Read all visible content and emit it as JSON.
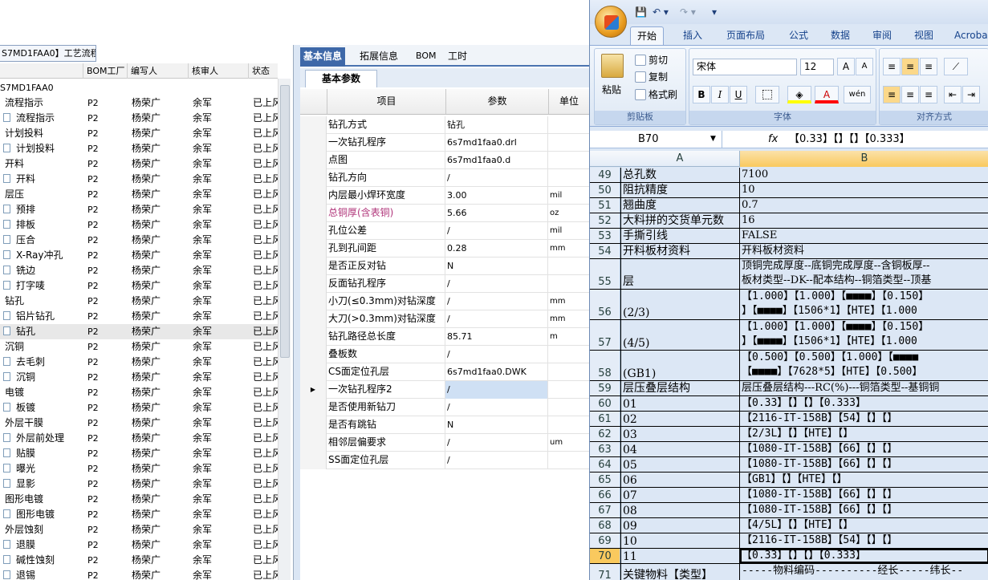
{
  "left_panel": {
    "title": "S7MD1FAA0】工艺流程",
    "headers": [
      "",
      "BOM工厂",
      "编写人",
      "核审人",
      "状态"
    ],
    "root": "S7MD1FAA0",
    "rows": [
      {
        "label": "流程指示",
        "level": 0,
        "factory": "P2",
        "writer": "杨荣广",
        "reviewer": "余军",
        "status": "已上风"
      },
      {
        "label": "流程指示",
        "level": 1,
        "factory": "P2",
        "writer": "杨荣广",
        "reviewer": "余军",
        "status": "已上风"
      },
      {
        "label": "计划投料",
        "level": 0,
        "factory": "P2",
        "writer": "杨荣广",
        "reviewer": "余军",
        "status": "已上风"
      },
      {
        "label": "计划投料",
        "level": 1,
        "factory": "P2",
        "writer": "杨荣广",
        "reviewer": "余军",
        "status": "已上风"
      },
      {
        "label": "开料",
        "level": 0,
        "factory": "P2",
        "writer": "杨荣广",
        "reviewer": "余军",
        "status": "已上风"
      },
      {
        "label": "开料",
        "level": 1,
        "factory": "P2",
        "writer": "杨荣广",
        "reviewer": "余军",
        "status": "已上风"
      },
      {
        "label": "层压",
        "level": 0,
        "factory": "P2",
        "writer": "杨荣广",
        "reviewer": "余军",
        "status": "已上风"
      },
      {
        "label": "预排",
        "level": 1,
        "factory": "P2",
        "writer": "杨荣广",
        "reviewer": "余军",
        "status": "已上风"
      },
      {
        "label": "排板",
        "level": 1,
        "factory": "P2",
        "writer": "杨荣广",
        "reviewer": "余军",
        "status": "已上风"
      },
      {
        "label": "压合",
        "level": 1,
        "factory": "P2",
        "writer": "杨荣广",
        "reviewer": "余军",
        "status": "已上风"
      },
      {
        "label": "X-Ray冲孔",
        "level": 1,
        "factory": "P2",
        "writer": "杨荣广",
        "reviewer": "余军",
        "status": "已上风"
      },
      {
        "label": "铣边",
        "level": 1,
        "factory": "P2",
        "writer": "杨荣广",
        "reviewer": "余军",
        "status": "已上风"
      },
      {
        "label": "打字唛",
        "level": 1,
        "factory": "P2",
        "writer": "杨荣广",
        "reviewer": "余军",
        "status": "已上风"
      },
      {
        "label": "钻孔",
        "level": 0,
        "factory": "P2",
        "writer": "杨荣广",
        "reviewer": "余军",
        "status": "已上风"
      },
      {
        "label": "铝片钻孔",
        "level": 1,
        "factory": "P2",
        "writer": "杨荣广",
        "reviewer": "余军",
        "status": "已上风"
      },
      {
        "label": "钻孔",
        "level": 1,
        "factory": "P2",
        "writer": "杨荣广",
        "reviewer": "余军",
        "status": "已上风",
        "selected": true
      },
      {
        "label": "沉铜",
        "level": 0,
        "factory": "P2",
        "writer": "杨荣广",
        "reviewer": "余军",
        "status": "已上风"
      },
      {
        "label": "去毛刺",
        "level": 1,
        "factory": "P2",
        "writer": "杨荣广",
        "reviewer": "余军",
        "status": "已上风"
      },
      {
        "label": "沉铜",
        "level": 1,
        "factory": "P2",
        "writer": "杨荣广",
        "reviewer": "余军",
        "status": "已上风"
      },
      {
        "label": "电镀",
        "level": 0,
        "factory": "P2",
        "writer": "杨荣广",
        "reviewer": "余军",
        "status": "已上风"
      },
      {
        "label": "板镀",
        "level": 1,
        "factory": "P2",
        "writer": "杨荣广",
        "reviewer": "余军",
        "status": "已上风"
      },
      {
        "label": "外层干膜",
        "level": 0,
        "factory": "P2",
        "writer": "杨荣广",
        "reviewer": "余军",
        "status": "已上风"
      },
      {
        "label": "外层前处理",
        "level": 1,
        "factory": "P2",
        "writer": "杨荣广",
        "reviewer": "余军",
        "status": "已上风"
      },
      {
        "label": "贴膜",
        "level": 1,
        "factory": "P2",
        "writer": "杨荣广",
        "reviewer": "余军",
        "status": "已上风"
      },
      {
        "label": "曝光",
        "level": 1,
        "factory": "P2",
        "writer": "杨荣广",
        "reviewer": "余军",
        "status": "已上风"
      },
      {
        "label": "显影",
        "level": 1,
        "factory": "P2",
        "writer": "杨荣广",
        "reviewer": "余军",
        "status": "已上风"
      },
      {
        "label": "图形电镀",
        "level": 0,
        "factory": "P2",
        "writer": "杨荣广",
        "reviewer": "余军",
        "status": "已上风"
      },
      {
        "label": "图形电镀",
        "level": 1,
        "factory": "P2",
        "writer": "杨荣广",
        "reviewer": "余军",
        "status": "已上风"
      },
      {
        "label": "外层蚀刻",
        "level": 0,
        "factory": "P2",
        "writer": "杨荣广",
        "reviewer": "余军",
        "status": "已上风"
      },
      {
        "label": "退膜",
        "level": 1,
        "factory": "P2",
        "writer": "杨荣广",
        "reviewer": "余军",
        "status": "已上风"
      },
      {
        "label": "碱性蚀刻",
        "level": 1,
        "factory": "P2",
        "writer": "杨荣广",
        "reviewer": "余军",
        "status": "已上风"
      },
      {
        "label": "退锡",
        "level": 1,
        "factory": "P2",
        "writer": "杨荣广",
        "reviewer": "余军",
        "status": "已上风"
      }
    ]
  },
  "middle_panel": {
    "tabs": [
      "基本信息",
      "拓展信息",
      "BOM",
      "工时"
    ],
    "active_tab": 0,
    "subtab": "基本参数",
    "headers": [
      "项目",
      "参数",
      "单位"
    ],
    "rows": [
      {
        "item": "钻孔方式",
        "value": "钻孔",
        "unit": ""
      },
      {
        "item": "一次钻孔程序",
        "value": "6s7md1faa0.drl",
        "unit": ""
      },
      {
        "item": "点图",
        "value": "6s7md1faa0.d",
        "unit": ""
      },
      {
        "item": "钻孔方向",
        "value": "/",
        "unit": ""
      },
      {
        "item": "内层最小焊环宽度",
        "value": "3.00",
        "unit": "mil"
      },
      {
        "item": "总铜厚(含表铜)",
        "value": "5.66",
        "unit": "oz",
        "highlight": true
      },
      {
        "item": "孔位公差",
        "value": "/",
        "unit": "mil"
      },
      {
        "item": "孔到孔间距",
        "value": "0.28",
        "unit": "mm"
      },
      {
        "item": "是否正反对钻",
        "value": "N",
        "unit": ""
      },
      {
        "item": "反面钻孔程序",
        "value": "/",
        "unit": ""
      },
      {
        "item": "小刀(≤0.3mm)对钻深度",
        "value": "/",
        "unit": "mm"
      },
      {
        "item": "大刀(>0.3mm)对钻深度",
        "value": "/",
        "unit": "mm"
      },
      {
        "item": "钻孔路径总长度",
        "value": "85.71",
        "unit": "m"
      },
      {
        "item": "叠板数",
        "value": "/",
        "unit": ""
      },
      {
        "item": "CS面定位孔层",
        "value": "6s7md1faa0.DWK",
        "unit": ""
      },
      {
        "item": "一次钻孔程序2",
        "value": "/",
        "unit": "",
        "selected": true
      },
      {
        "item": "是否使用新钻刀",
        "value": "/",
        "unit": ""
      },
      {
        "item": "是否有跳钻",
        "value": "N",
        "unit": ""
      },
      {
        "item": "相邻层偏要求",
        "value": "/",
        "unit": "um"
      },
      {
        "item": "SS面定位孔层",
        "value": "/",
        "unit": ""
      }
    ]
  },
  "excel": {
    "qat": [
      "💾",
      "↶ ▾",
      "↷ ▾",
      "▾"
    ],
    "tabs": [
      "开始",
      "插入",
      "页面布局",
      "公式",
      "数据",
      "审阅",
      "视图",
      "Acroba"
    ],
    "active_tab": 0,
    "clipboard": {
      "paste": "粘贴",
      "cut": "剪切",
      "copy": "复制",
      "format_painter": "格式刷",
      "label": "剪贴板"
    },
    "font": {
      "name": "宋体",
      "size": "12",
      "label": "字体",
      "grow": "A",
      "shrink": "A",
      "bold": "B",
      "italic": "I",
      "underline": "U",
      "wen": "wén"
    },
    "align": {
      "label": "对齐方式"
    },
    "name_box": "B70",
    "fx": "fx",
    "formula": "【0.33】【】【】【0.333】",
    "columns": [
      "A",
      "B"
    ],
    "rows": [
      {
        "n": "49",
        "a": "总孔数",
        "b": "7100",
        "h": 19
      },
      {
        "n": "50",
        "a": "阻抗精度",
        "b": "10",
        "h": 19
      },
      {
        "n": "51",
        "a": "翘曲度",
        "b": "0.7",
        "h": 19
      },
      {
        "n": "52",
        "a": "大料拼的交货单元数",
        "b": "16",
        "h": 19
      },
      {
        "n": "53",
        "a": "手撕引线",
        "b": "FALSE",
        "h": 19
      },
      {
        "n": "54",
        "a": "开料板材资料",
        "b": "开料板材资料",
        "h": 19
      },
      {
        "n": "55",
        "a": "层",
        "b": "顶铜完成厚度--底铜完成厚度--含铜板厚--\n板材类型--DK--配本结构--铜箔类型--顶基",
        "h": 38
      },
      {
        "n": "56",
        "a": "(2/3)",
        "b": "【1.000】【1.000】【■■■■】【0.150】\n】【■■■■】【1506*1】【HTE】【1.000",
        "h": 38
      },
      {
        "n": "57",
        "a": "(4/5)",
        "b": "【1.000】【1.000】【■■■■】【0.150】\n】【■■■■】【1506*1】【HTE】【1.000",
        "h": 38
      },
      {
        "n": "58",
        "a": "(GB1)",
        "b": "【0.500】【0.500】【1.000】【■■■■\n【■■■■】【7628*5】【HTE】【0.500】",
        "h": 38
      },
      {
        "n": "59",
        "a": "层压叠层结构",
        "b": "层压叠层结构---RC(%)---铜箔类型--基铜铜",
        "h": 19
      },
      {
        "n": "60",
        "a": "01",
        "b": "【0.33】【】【】【0.333】",
        "h": 19
      },
      {
        "n": "61",
        "a": "02",
        "b": "【2116-IT-158B】【54】【】【】",
        "h": 19
      },
      {
        "n": "62",
        "a": "03",
        "b": "【2/3L】【】【HTE】【】",
        "h": 19
      },
      {
        "n": "63",
        "a": "04",
        "b": "【1080-IT-158B】【66】【】【】",
        "h": 19
      },
      {
        "n": "64",
        "a": "05",
        "b": "【1080-IT-158B】【66】【】【】",
        "h": 19
      },
      {
        "n": "65",
        "a": "06",
        "b": "【GB1】【】【HTE】【】",
        "h": 19
      },
      {
        "n": "66",
        "a": "07",
        "b": "【1080-IT-158B】【66】【】【】",
        "h": 19
      },
      {
        "n": "67",
        "a": "08",
        "b": "【1080-IT-158B】【66】【】【】",
        "h": 19
      },
      {
        "n": "68",
        "a": "09",
        "b": "【4/5L】【】【HTE】【】",
        "h": 19
      },
      {
        "n": "69",
        "a": "10",
        "b": "【2116-IT-158B】【54】【】【】",
        "h": 19
      },
      {
        "n": "70",
        "a": "11",
        "b": "【0.33】【】【】【0.333】",
        "h": 19,
        "selected": true
      },
      {
        "n": "71",
        "a": "关键物料【类型】",
        "b": "-----物料编码----------经长-----纬长--",
        "h": 24
      }
    ]
  }
}
